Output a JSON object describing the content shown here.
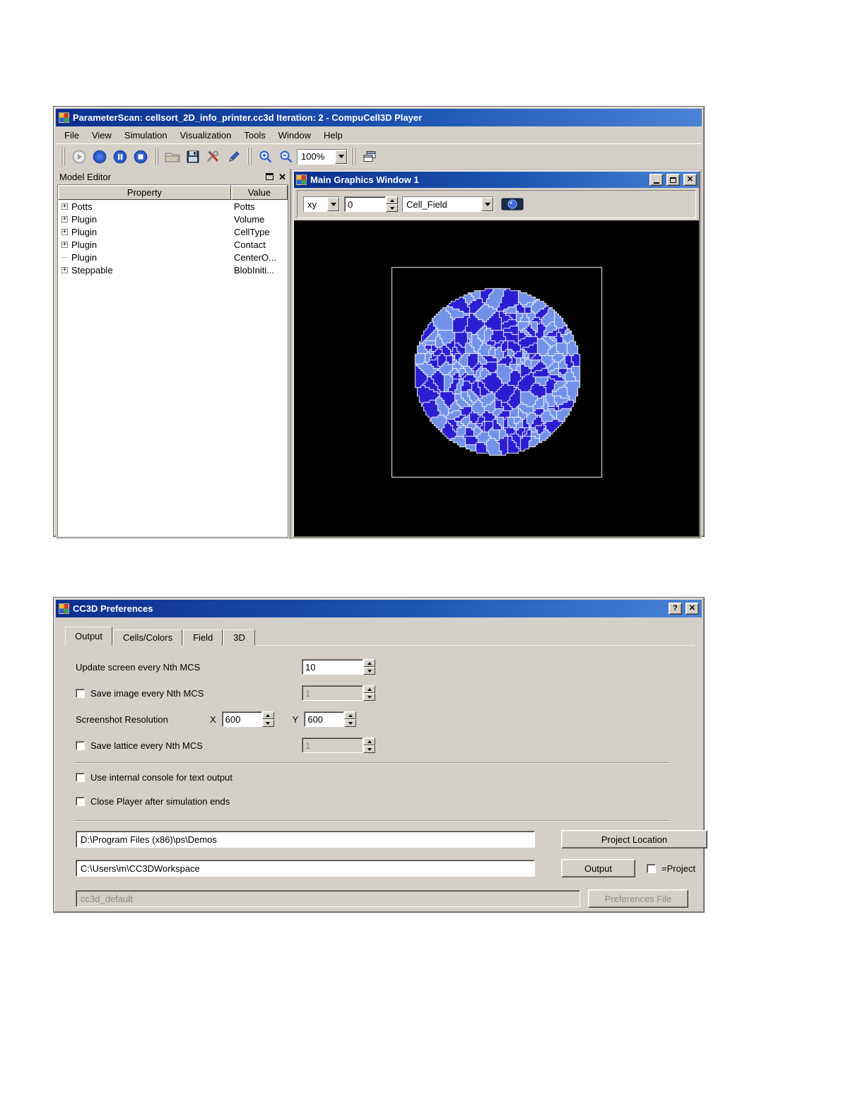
{
  "main_window": {
    "title": "ParameterScan: cellsort_2D_info_printer.cc3d Iteration: 2 - CompuCell3D Player",
    "menu_items": [
      "File",
      "View",
      "Simulation",
      "Visualization",
      "Tools",
      "Window",
      "Help"
    ],
    "toolbar": {
      "zoom_level": "100%"
    },
    "model_editor": {
      "title": "Model Editor",
      "columns": [
        "Property",
        "Value"
      ],
      "rows": [
        {
          "property": "Potts",
          "value": "Potts",
          "expander": "+"
        },
        {
          "property": "Plugin",
          "value": "Volume",
          "expander": "+"
        },
        {
          "property": "Plugin",
          "value": "CellType",
          "expander": "+"
        },
        {
          "property": "Plugin",
          "value": "Contact",
          "expander": "+"
        },
        {
          "property": "Plugin",
          "value": "CenterO...",
          "expander": ""
        },
        {
          "property": "Steppable",
          "value": "BlobIniti...",
          "expander": "+"
        }
      ]
    },
    "graphics_window": {
      "title": "Main Graphics Window 1",
      "plane": "xy",
      "plane_index": "0",
      "field": "Cell_Field",
      "colors": {
        "canvas_bg": "#000000",
        "lattice_border": "#ffffff",
        "cell_dark": "#2a1ed2",
        "cell_light": "#7292ea",
        "cell_outline": "#ffffff"
      }
    }
  },
  "preferences": {
    "title": "CC3D Preferences",
    "tabs": [
      "Output",
      "Cells/Colors",
      "Field",
      "3D"
    ],
    "update_screen": {
      "label": "Update screen every Nth MCS",
      "value": "10"
    },
    "save_image": {
      "label": "Save image every Nth MCS",
      "value": "1"
    },
    "screenshot": {
      "label": "Screenshot Resolution",
      "x_label": "X",
      "x": "600",
      "y_label": "Y",
      "y": "600"
    },
    "save_lattice": {
      "label": "Save lattice every Nth MCS",
      "value": "1"
    },
    "console_label": "Use internal console for text output",
    "close_player_label": "Close Player after simulation ends",
    "project_path": "D:\\Program Files (x86)\\ps\\Demos",
    "project_location_button": "Project Location",
    "output_path": "C:\\Users\\m\\CC3DWorkspace",
    "output_button": "Output",
    "eq_project_label": "=Project",
    "prefs_file_value": "cc3d_default",
    "prefs_file_button": "Preferences File",
    "help_button": "?"
  }
}
